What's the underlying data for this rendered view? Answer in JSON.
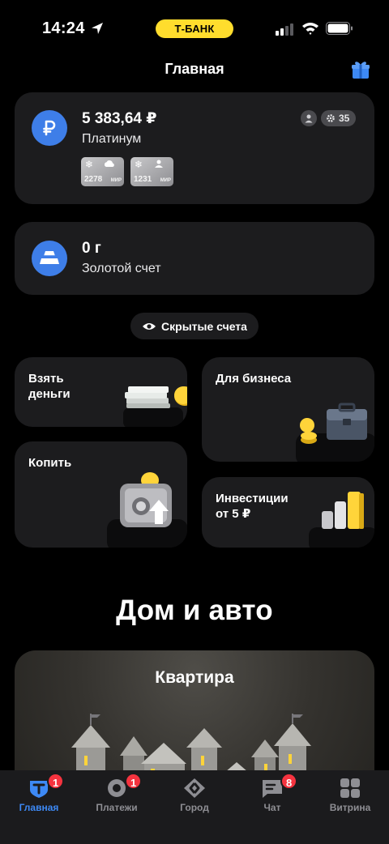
{
  "status_bar": {
    "time": "14:24",
    "bank_pill": "Т-БАНК"
  },
  "header": {
    "title": "Главная"
  },
  "accounts": [
    {
      "amount": "5 383,64 ₽",
      "name": "Платинум",
      "currency_icon": "ruble-icon",
      "points": "35",
      "cards": [
        {
          "number": "2278",
          "system": "МИР"
        },
        {
          "number": "1231",
          "system": "МИР"
        }
      ]
    },
    {
      "amount": "0 г",
      "name": "Золотой счет",
      "currency_icon": "gold-bar-icon"
    }
  ],
  "hidden_accounts_label": "Скрытые счета",
  "tiles": {
    "borrow": "Взять\nденьги",
    "business": "Для бизнеса",
    "save": "Копить",
    "invest": "Инвестиции\nот 5 ₽"
  },
  "section_title": "Дом и авто",
  "promo": {
    "title": "Квартира"
  },
  "tab_bar": [
    {
      "label": "Главная",
      "icon": "home-t-icon",
      "badge": "1",
      "active": true
    },
    {
      "label": "Платежи",
      "icon": "payments-icon",
      "badge": "1",
      "active": false
    },
    {
      "label": "Город",
      "icon": "city-icon",
      "badge": "",
      "active": false
    },
    {
      "label": "Чат",
      "icon": "chat-icon",
      "badge": "8",
      "active": false
    },
    {
      "label": "Витрина",
      "icon": "showcase-icon",
      "badge": "",
      "active": false
    }
  ],
  "colors": {
    "accent_blue": "#3d89f5",
    "brand_yellow": "#ffdd2d",
    "badge_red": "#f5333f",
    "card_bg": "#1c1c1e"
  }
}
